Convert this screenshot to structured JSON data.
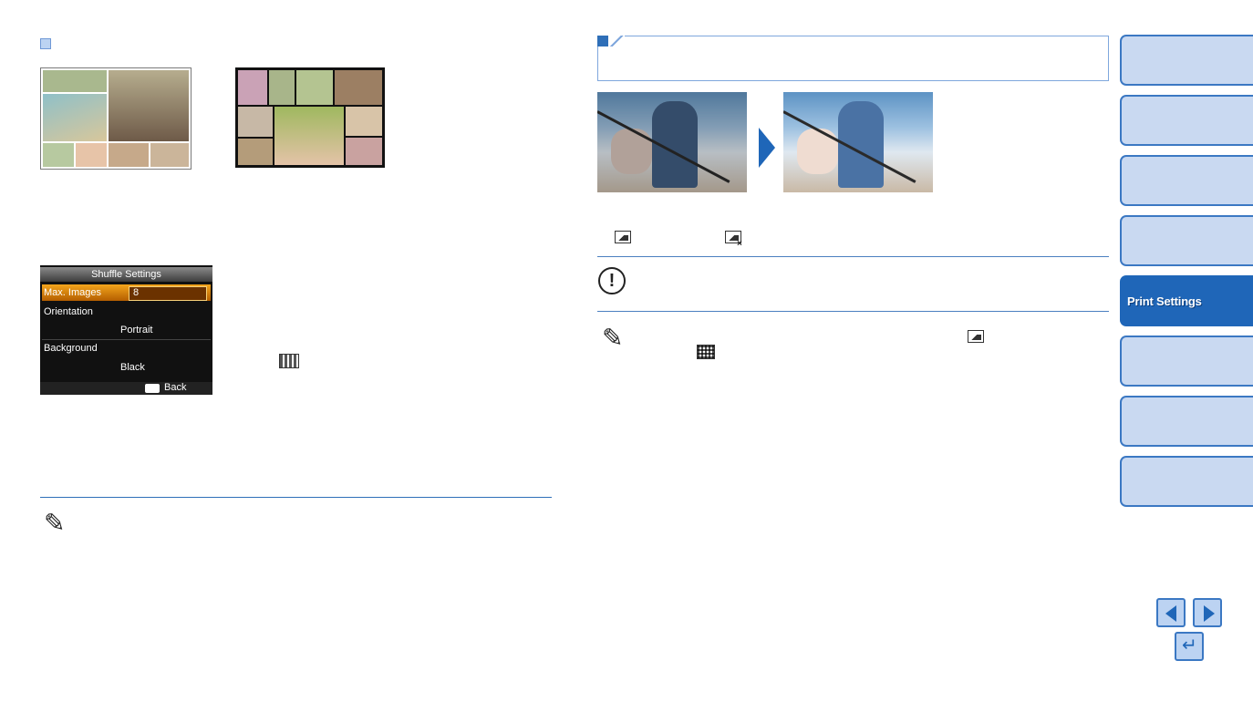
{
  "lcd": {
    "title": "Shuffle Settings",
    "row1_label": "Max. Images",
    "row1_value": "8",
    "row2_label": "Orientation",
    "row2_value": "Portrait",
    "row3_label": "Background",
    "row3_value": "Black",
    "back_label": "Back"
  },
  "icons": {
    "shuffle_grid": "grid-layout-icon",
    "image_on": "image-icon",
    "image_off": "image-off-icon",
    "caution": "caution-icon",
    "memo": "pencil-icon"
  },
  "sidebar": {
    "tabs": [
      {
        "label": ""
      },
      {
        "label": ""
      },
      {
        "label": ""
      },
      {
        "label": ""
      },
      {
        "label": "Print Settings",
        "active": true
      },
      {
        "label": ""
      },
      {
        "label": ""
      },
      {
        "label": ""
      }
    ]
  },
  "colors": {
    "accent": "#1f66b8",
    "tab_fill": "#c9d9f1"
  }
}
